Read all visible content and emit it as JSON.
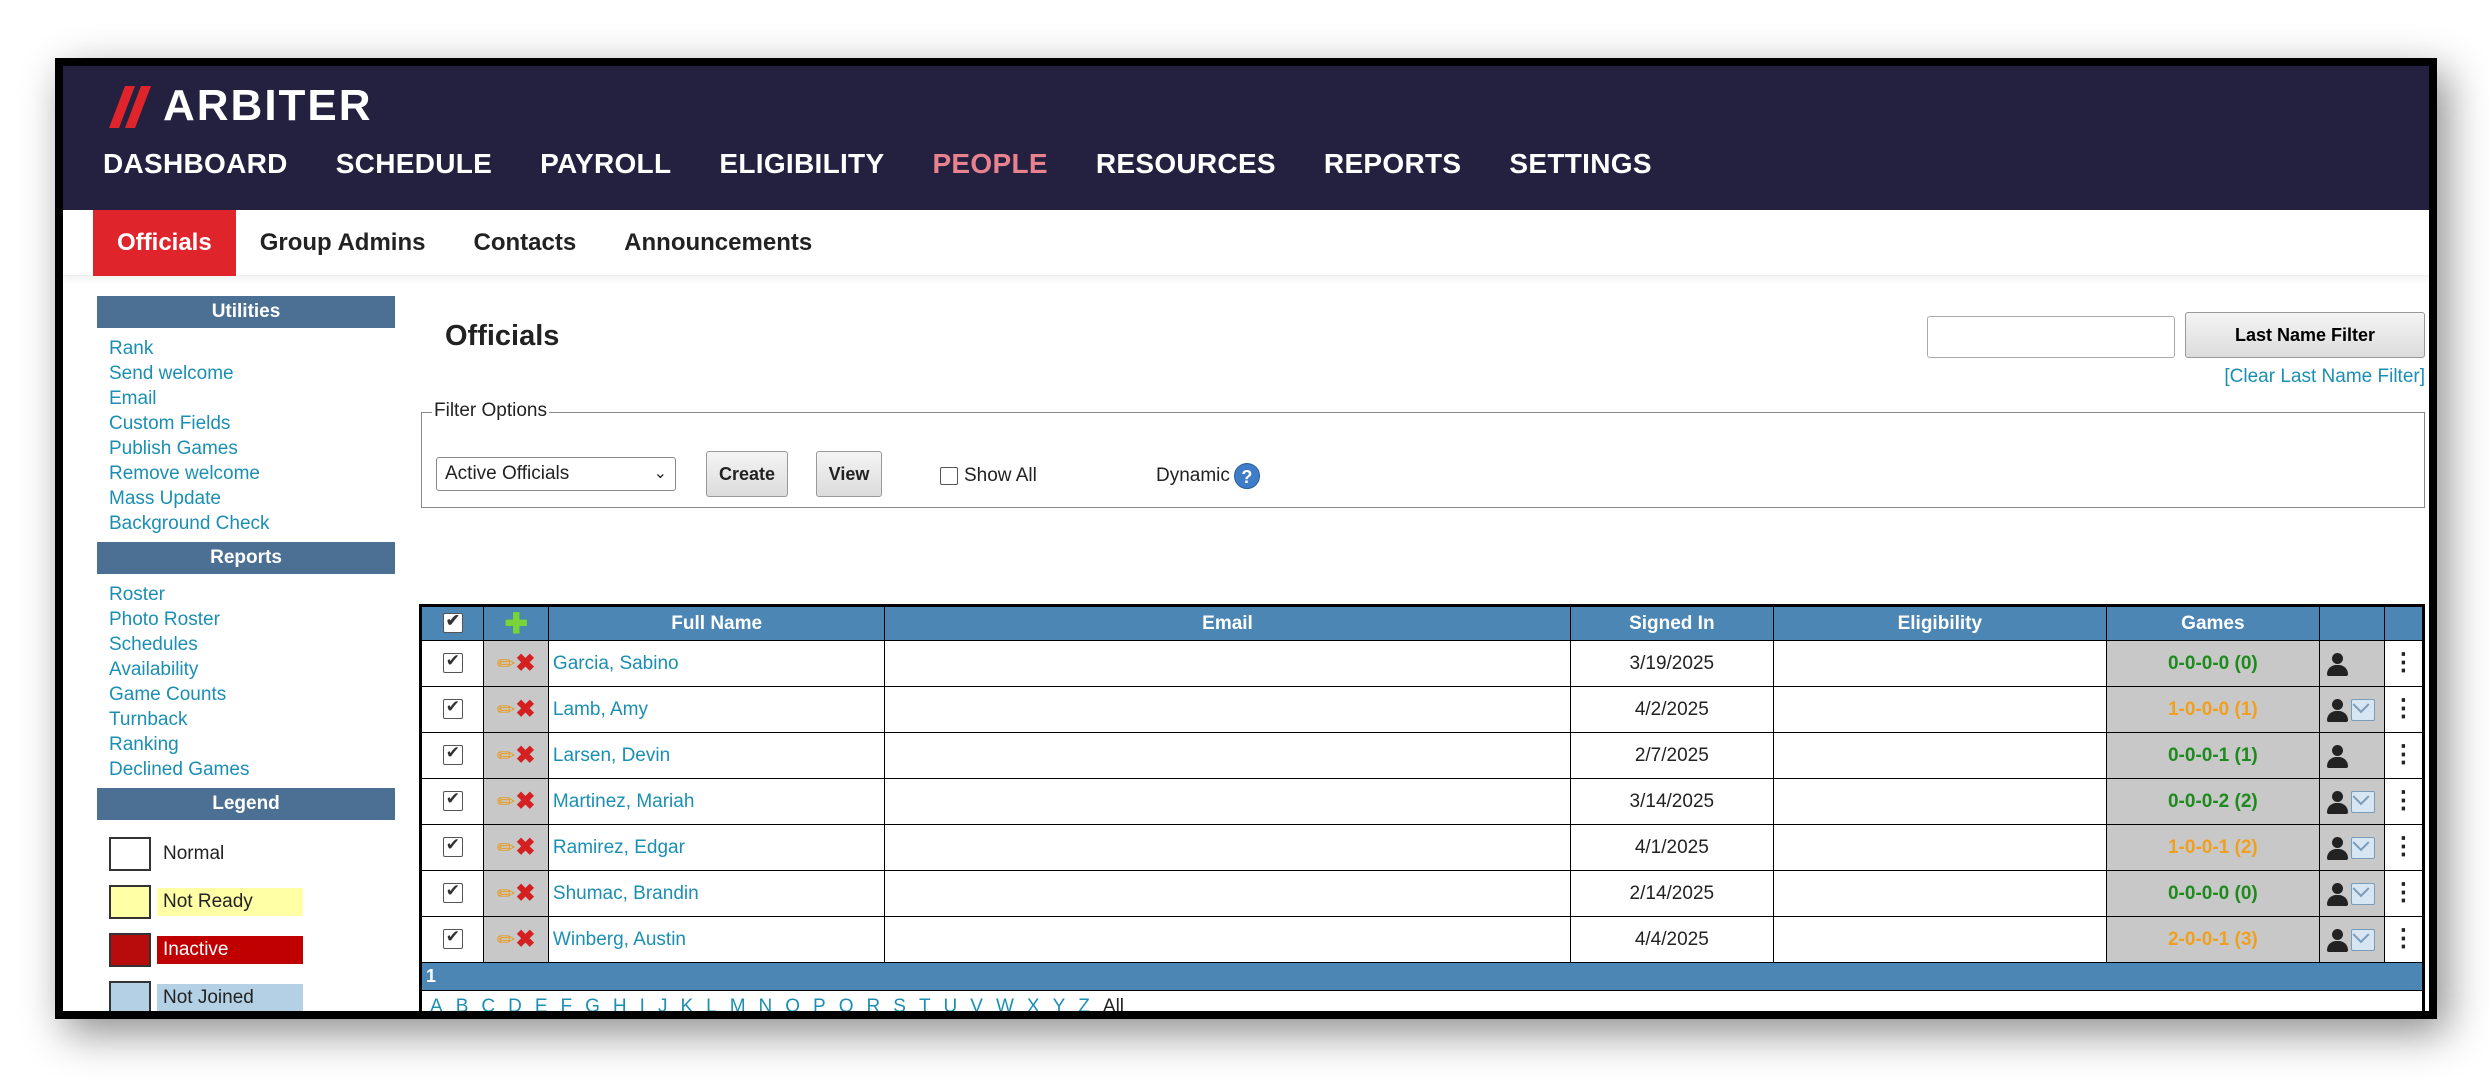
{
  "brand": {
    "name": "ARBITER"
  },
  "nav": {
    "items": [
      "DASHBOARD",
      "SCHEDULE",
      "PAYROLL",
      "ELIGIBILITY",
      "PEOPLE",
      "RESOURCES",
      "REPORTS",
      "SETTINGS"
    ],
    "active": "PEOPLE"
  },
  "subnav": {
    "items": [
      "Officials",
      "Group Admins",
      "Contacts",
      "Announcements"
    ],
    "active": "Officials"
  },
  "sidebar": {
    "utilities_title": "Utilities",
    "utilities": [
      "Rank",
      "Send welcome",
      "Email",
      "Custom Fields",
      "Publish Games",
      "Remove welcome",
      "Mass Update",
      "Background Check"
    ],
    "reports_title": "Reports",
    "reports": [
      "Roster",
      "Photo Roster",
      "Schedules",
      "Availability",
      "Game Counts",
      "Turnback",
      "Ranking",
      "Declined Games"
    ],
    "legend_title": "Legend",
    "legend": [
      {
        "label": "Normal",
        "box": "#ffffff",
        "label_bg": "#ffffff",
        "label_color": "#222222"
      },
      {
        "label": "Not Ready",
        "box": "#ffffa6",
        "label_bg": "#ffffa6",
        "label_color": "#222222"
      },
      {
        "label": "Inactive",
        "box": "#b80c0c",
        "label_bg": "#c00000",
        "label_color": "#ffffff"
      },
      {
        "label": "Not Joined",
        "box": "#b4d0e4",
        "label_bg": "#b4d0e4",
        "label_color": "#222222"
      }
    ]
  },
  "main": {
    "title": "Officials",
    "name_filter": {
      "value": "",
      "placeholder": "",
      "button": "Last Name Filter",
      "clear": "[Clear Last Name Filter]"
    },
    "filter": {
      "legend": "Filter Options",
      "selected": "Active Officials",
      "create": "Create",
      "view": "View",
      "show_all": "Show All",
      "dynamic": "Dynamic",
      "help": "?"
    }
  },
  "table": {
    "headers": {
      "full_name": "Full Name",
      "email": "Email",
      "signed_in": "Signed In",
      "eligibility": "Eligibility",
      "games": "Games"
    },
    "rows": [
      {
        "name": "Garcia, Sabino",
        "email": "",
        "signed_in": "3/19/2025",
        "eligibility": "",
        "games": "0-0-0-0 (0)",
        "games_color": "green",
        "mail": false
      },
      {
        "name": "Lamb, Amy",
        "email": "",
        "signed_in": "4/2/2025",
        "eligibility": "",
        "games": "1-0-0-0 (1)",
        "games_color": "orange",
        "mail": true
      },
      {
        "name": "Larsen, Devin",
        "email": "",
        "signed_in": "2/7/2025",
        "eligibility": "",
        "games": "0-0-0-1 (1)",
        "games_color": "green",
        "mail": false
      },
      {
        "name": "Martinez, Mariah",
        "email": "",
        "signed_in": "3/14/2025",
        "eligibility": "",
        "games": "0-0-0-2 (2)",
        "games_color": "green",
        "mail": true
      },
      {
        "name": "Ramirez, Edgar",
        "email": "",
        "signed_in": "4/1/2025",
        "eligibility": "",
        "games": "1-0-0-1 (2)",
        "games_color": "orange",
        "mail": true
      },
      {
        "name": "Shumac, Brandin",
        "email": "",
        "signed_in": "2/14/2025",
        "eligibility": "",
        "games": "0-0-0-0 (0)",
        "games_color": "green",
        "mail": true
      },
      {
        "name": "Winberg, Austin",
        "email": "",
        "signed_in": "4/4/2025",
        "eligibility": "",
        "games": "2-0-0-1 (3)",
        "games_color": "orange",
        "mail": true
      }
    ],
    "page": "1",
    "alphabet": [
      "A",
      "B",
      "C",
      "D",
      "E",
      "F",
      "G",
      "H",
      "I",
      "J",
      "K",
      "L",
      "M",
      "N",
      "O",
      "P",
      "Q",
      "R",
      "S",
      "T",
      "U",
      "V",
      "W",
      "X",
      "Y",
      "Z"
    ],
    "all_label": "All"
  },
  "icons": {
    "logo": "arbiter-logo-icon",
    "add": "plus-icon",
    "edit": "pencil-icon",
    "delete": "x-icon",
    "profile": "person-icon",
    "mail": "mail-icon",
    "more": "kebab-icon"
  },
  "colors": {
    "header_bg": "#24203f",
    "active_nav": "#e8828e",
    "accent_red": "#e0242b",
    "table_header": "#4b86b4",
    "sidebar_header": "#4b7094",
    "link": "#1b8fb3"
  }
}
